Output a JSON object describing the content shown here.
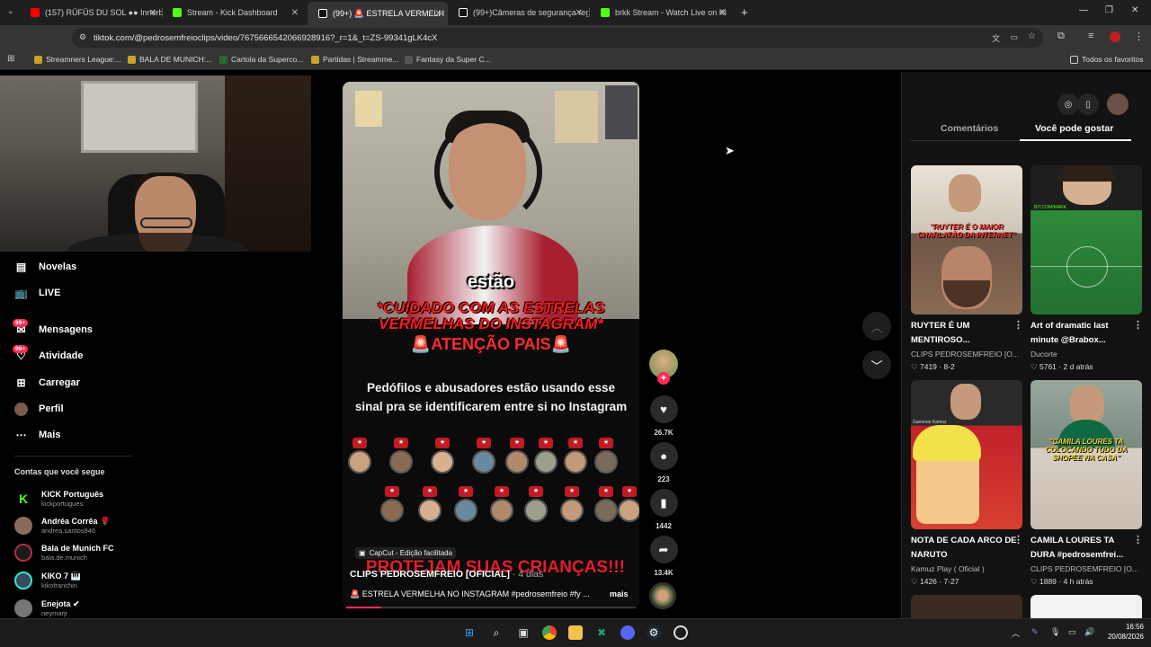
{
  "browser": {
    "tabs": [
      {
        "title": "(157) RÜFÜS DU SOL ●● Innerb",
        "favicon_color": "#ff0000"
      },
      {
        "title": "Stream - Kick Dashboard",
        "favicon_color": "#53fc18"
      },
      {
        "title": "(99+) 🚨 ESTRELA VERMELH",
        "favicon_color": "#ffffff"
      },
      {
        "title": "(99+)Câmeras de segurança reg",
        "favicon_color": "#ffffff"
      },
      {
        "title": "brkk Stream - Watch Live on Ki",
        "favicon_color": "#53fc18"
      }
    ],
    "active_tab_index": 2,
    "url": "tiktok.com/@pedrosemfreioclips/video/7675666542066928916?_r=1&_t=ZS-99341gLK4cX",
    "bookmarks": [
      "Streamners League:...",
      "BALA DE MUNICH:...",
      "Cartola da Superco...",
      "Partidas | Streamme...",
      "Fantasy da Super C..."
    ],
    "all_bookmarks": "Todos os favoritos"
  },
  "sidebar": {
    "nav": [
      {
        "label": "Novelas",
        "icon": "novelas-icon"
      },
      {
        "label": "LIVE",
        "icon": "live-tv-icon"
      },
      {
        "label": "Mensagens",
        "icon": "messages-icon",
        "badge": "99+"
      },
      {
        "label": "Atividade",
        "icon": "activity-icon",
        "badge": "99+"
      },
      {
        "label": "Carregar",
        "icon": "upload-icon"
      },
      {
        "label": "Perfil",
        "icon": "profile-avatar-icon"
      },
      {
        "label": "Mais",
        "icon": "more-icon"
      }
    ],
    "following_title": "Contas que você segue",
    "following": [
      {
        "name": "KICK Português",
        "handle": "kickportugues",
        "color": "#53fc18"
      },
      {
        "name": "Andréa Corrêa 🌹",
        "handle": "andrea.santos946",
        "color": "#8a6b5a"
      },
      {
        "name": "Bala de Munich FC",
        "handle": "bala.de.munich",
        "color": "#b0303a"
      },
      {
        "name": "KIKO 7 🎹",
        "handle": "kikofranchin",
        "color": "#3a4a5a"
      },
      {
        "name": "Enejota ✔",
        "handle": "neymarjr",
        "color": "#777777"
      }
    ]
  },
  "video": {
    "caption_word": "estão",
    "red_caption": "*CUIDADO COM AS ESTRELAS VERMELHAS DO INSTAGRAM*",
    "atencao": "🚨ATENÇÃO PAIS🚨",
    "warning_text": "Pedófilos e abusadores estão usando esse sinal pra se identificarem entre si no Instagram",
    "capcut": "CapCut - Edição facilitada",
    "protejam": "PROTEJAM SUAS CRIANÇAS!!!",
    "author": "CLIPS PEDROSEMFREIO [OFICIAL]",
    "author_suffix": "· 4 dias",
    "description": "🚨 ESTRELA VERMELHA NO INSTAGRAM #pedrosemfreio #fy ...",
    "more": "mais",
    "progress": 0.12
  },
  "actions": {
    "likes": "26.7K",
    "comments": "223",
    "saves": "1442",
    "shares": "13.4K"
  },
  "right_panel": {
    "tabs": [
      "Comentários",
      "Você pode gostar"
    ],
    "active_tab": 1,
    "videos": [
      {
        "title": "RUYTER É UM MENTIROSO...",
        "author": "CLIPS PEDROSEMFREIO [O...",
        "likes": "7419",
        "date": "8-2",
        "overlay": "\"RUYTER É O MAIOR CHARLATÃO DA INTERNET\""
      },
      {
        "title": "Art of dramatic last minute @Brabox...",
        "author": "Ducorte",
        "likes": "5761",
        "date": "2 d atrás",
        "overlay": "BIT.COM/MARK"
      },
      {
        "title": "NOTA DE CADA ARCO DE NARUTO",
        "author": "Kamuz Play ( Oficial )",
        "likes": "1426",
        "date": "7-27",
        "overlay": "Gamevar Kamuz"
      },
      {
        "title": "CAMILA LOURES TA DURA #pedrosemfrei...",
        "author": "CLIPS PEDROSEMFREIO [O...",
        "likes": "1889",
        "date": "4 h atrás",
        "overlay": "\"CAMILA LOURES TA COLOCANDO TUDO DA SHOPEE NA CASA\""
      }
    ]
  },
  "taskbar": {
    "time": "16:56",
    "date": "20/08/2026"
  }
}
